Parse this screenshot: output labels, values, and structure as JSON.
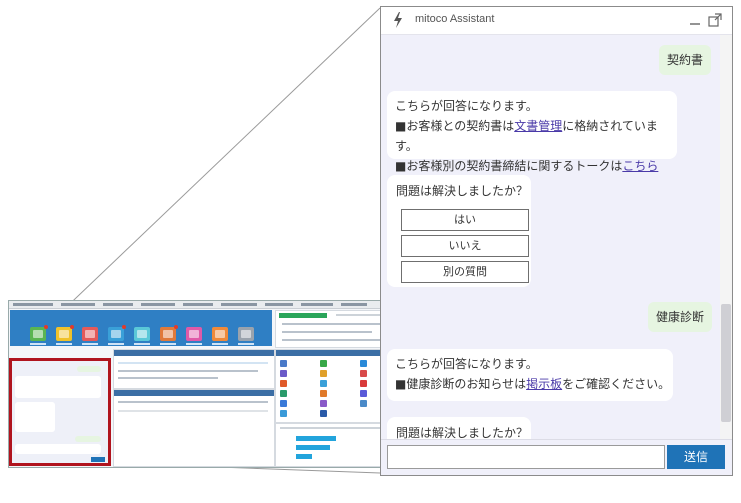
{
  "chat": {
    "title": "mitoco Assistant",
    "messages": [
      {
        "type": "user",
        "text": "契約書"
      },
      {
        "type": "bot",
        "line1": "こちらが回答になります。",
        "line2_pre": "■お客様との契約書は",
        "line2_link": "文書管理",
        "line2_post": "に格納されています。",
        "line3_pre": "■お客様別の契約書締結に関するトークは",
        "line3_link": "こちら"
      },
      {
        "type": "question",
        "text": "問題は解決しましたか？",
        "options": [
          "はい",
          "いいえ",
          "別の質問"
        ]
      },
      {
        "type": "user",
        "text": "健康診断"
      },
      {
        "type": "bot",
        "line1": "こちらが回答になります。",
        "line2_pre": "■健康診断のお知らせは",
        "line2_link": "掲示板",
        "line2_post": "をご確認ください。"
      },
      {
        "type": "question",
        "text": "問題は解決しましたか？"
      }
    ],
    "input": {
      "placeholder": ""
    },
    "send_label": "送信",
    "icons": {
      "logo": "lightning-bolt-icon",
      "minimize": "minimize-icon",
      "popout": "popout-icon"
    }
  },
  "colors": {
    "accent": "#1f73b7",
    "chat_bg": "#f0f0fa",
    "user_bubble": "#e6f5e1",
    "link": "#4a3aa8",
    "highlight_frame": "#b0141e"
  }
}
